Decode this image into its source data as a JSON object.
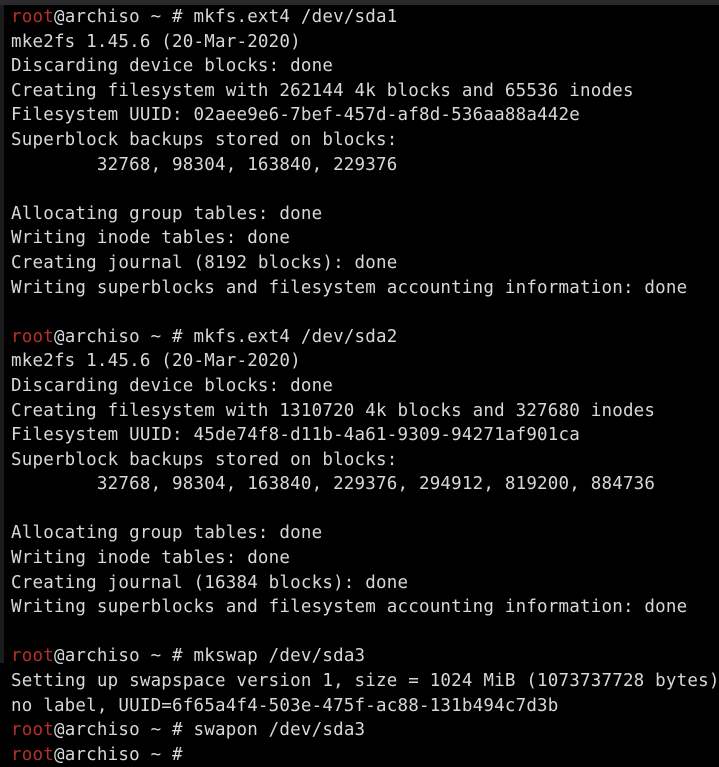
{
  "terminal": {
    "window_title": "root@archiso",
    "hostname": "archiso",
    "user": "root",
    "cwd_symbol": "~",
    "prompt_sigil": "#",
    "colors": {
      "background": "#000000",
      "foreground": "#d8d8d8",
      "prompt_user": "#b5302a",
      "top_strip": "#2a2a2a"
    },
    "lines": [
      {
        "type": "prompt",
        "user": "root",
        "rest": "@archiso ~ # mkfs.ext4 /dev/sda1"
      },
      {
        "type": "output",
        "text": "mke2fs 1.45.6 (20-Mar-2020)"
      },
      {
        "type": "output",
        "text": "Discarding device blocks: done"
      },
      {
        "type": "output",
        "text": "Creating filesystem with 262144 4k blocks and 65536 inodes"
      },
      {
        "type": "output",
        "text": "Filesystem UUID: 02aee9e6-7bef-457d-af8d-536aa88a442e"
      },
      {
        "type": "output",
        "text": "Superblock backups stored on blocks:"
      },
      {
        "type": "output",
        "text": "        32768, 98304, 163840, 229376"
      },
      {
        "type": "blank",
        "text": " "
      },
      {
        "type": "output",
        "text": "Allocating group tables: done"
      },
      {
        "type": "output",
        "text": "Writing inode tables: done"
      },
      {
        "type": "output",
        "text": "Creating journal (8192 blocks): done"
      },
      {
        "type": "output",
        "text": "Writing superblocks and filesystem accounting information: done"
      },
      {
        "type": "blank",
        "text": " "
      },
      {
        "type": "prompt",
        "user": "root",
        "rest": "@archiso ~ # mkfs.ext4 /dev/sda2"
      },
      {
        "type": "output",
        "text": "mke2fs 1.45.6 (20-Mar-2020)"
      },
      {
        "type": "output",
        "text": "Discarding device blocks: done"
      },
      {
        "type": "output",
        "text": "Creating filesystem with 1310720 4k blocks and 327680 inodes"
      },
      {
        "type": "output",
        "text": "Filesystem UUID: 45de74f8-d11b-4a61-9309-94271af901ca"
      },
      {
        "type": "output",
        "text": "Superblock backups stored on blocks:"
      },
      {
        "type": "output",
        "text": "        32768, 98304, 163840, 229376, 294912, 819200, 884736"
      },
      {
        "type": "blank",
        "text": " "
      },
      {
        "type": "output",
        "text": "Allocating group tables: done"
      },
      {
        "type": "output",
        "text": "Writing inode tables: done"
      },
      {
        "type": "output",
        "text": "Creating journal (16384 blocks): done"
      },
      {
        "type": "output",
        "text": "Writing superblocks and filesystem accounting information: done"
      },
      {
        "type": "blank",
        "text": " "
      },
      {
        "type": "prompt",
        "user": "root",
        "rest": "@archiso ~ # mkswap /dev/sda3"
      },
      {
        "type": "output",
        "text": "Setting up swapspace version 1, size = 1024 MiB (1073737728 bytes)"
      },
      {
        "type": "output",
        "text": "no label, UUID=6f65a4f4-503e-475f-ac88-131b494c7d3b"
      },
      {
        "type": "prompt",
        "user": "root",
        "rest": "@archiso ~ # swapon /dev/sda3"
      },
      {
        "type": "prompt",
        "user": "root",
        "rest": "@archiso ~ # "
      }
    ]
  }
}
